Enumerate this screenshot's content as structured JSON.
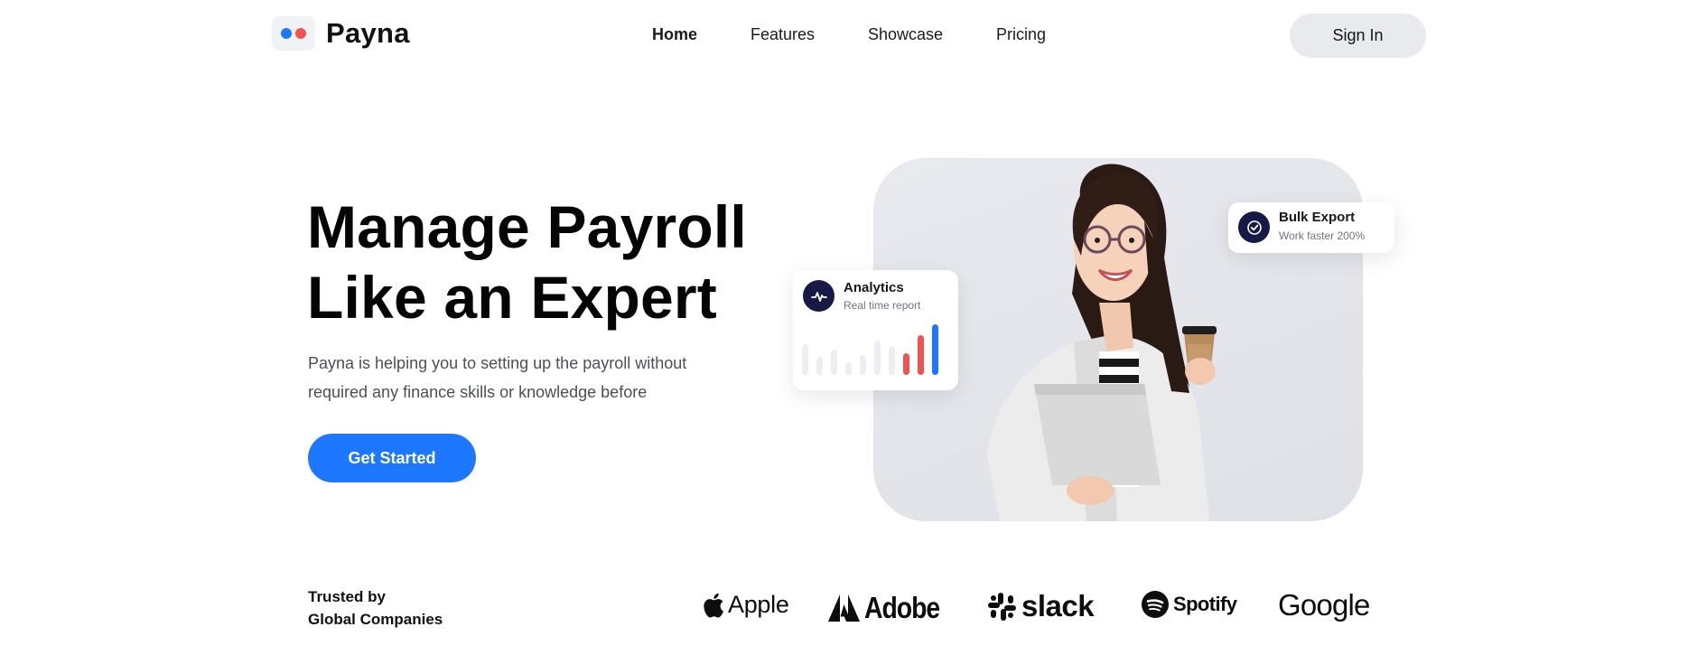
{
  "brand": {
    "name": "Payna"
  },
  "nav": {
    "items": [
      {
        "label": "Home",
        "active": true
      },
      {
        "label": "Features",
        "active": false
      },
      {
        "label": "Showcase",
        "active": false
      },
      {
        "label": "Pricing",
        "active": false
      }
    ],
    "sign_in_label": "Sign In"
  },
  "hero": {
    "headline_line1": "Manage Payroll",
    "headline_line2": "Like an Expert",
    "subtext_line1": "Payna is helping you to setting up the payroll without",
    "subtext_line2": "required any finance skills or knowledge before",
    "cta_label": "Get Started"
  },
  "cards": {
    "analytics": {
      "title": "Analytics",
      "subtitle": "Real time report",
      "icon": "pulse-icon"
    },
    "export": {
      "title": "Bulk Export",
      "subtitle": "Work faster 200%",
      "icon": "check-circle-icon"
    }
  },
  "trusted": {
    "line1": "Trusted by",
    "line2": "Global Companies",
    "logos": [
      {
        "name": "Apple",
        "icon": "apple-icon"
      },
      {
        "name": "Adobe",
        "icon": "adobe-icon"
      },
      {
        "name": "slack",
        "icon": "slack-icon"
      },
      {
        "name": "Spotify",
        "icon": "spotify-icon"
      },
      {
        "name": "Google",
        "icon": ""
      }
    ]
  },
  "colors": {
    "primary": "#1e78ff",
    "accent_red": "#f0524f",
    "dark_icon_bg": "#181a45",
    "card_bg": "#e4e6eb",
    "signin_bg": "#e9eaee"
  }
}
